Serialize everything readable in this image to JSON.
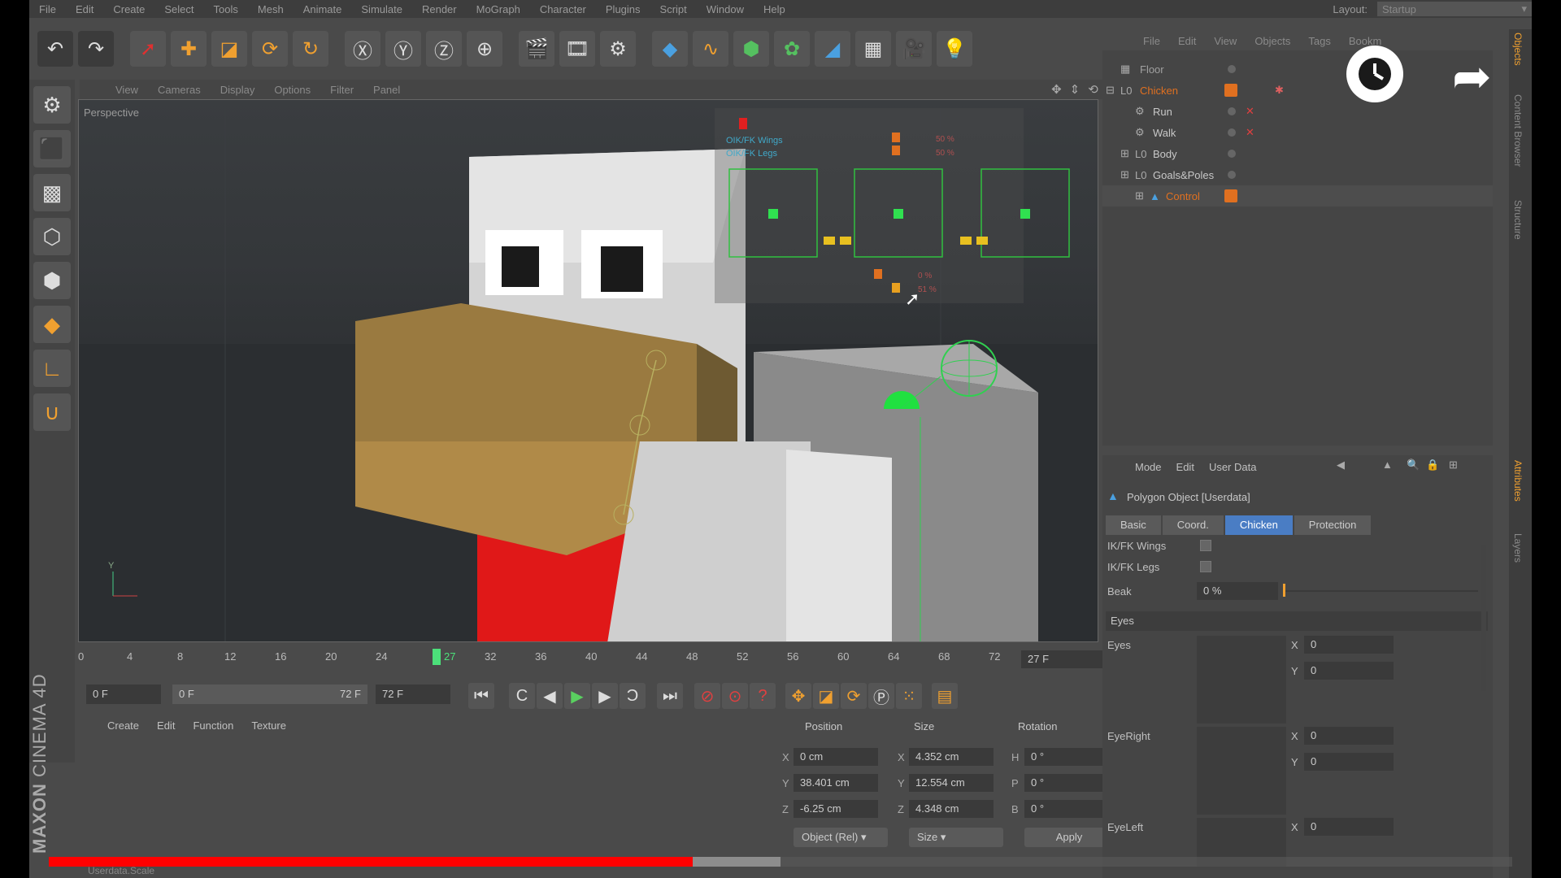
{
  "menu": [
    "File",
    "Edit",
    "Create",
    "Select",
    "Tools",
    "Mesh",
    "Animate",
    "Simulate",
    "Render",
    "MoGraph",
    "Character",
    "Plugins",
    "Script",
    "Window",
    "Help"
  ],
  "layout": {
    "label": "Layout:",
    "value": "Startup"
  },
  "viewport": {
    "menu": [
      "View",
      "Cameras",
      "Display",
      "Options",
      "Filter",
      "Panel"
    ],
    "label": "Perspective",
    "overlay_labels": [
      "OIK/FK Wings",
      "OIK/FK Legs"
    ],
    "slider_values": [
      "50 %",
      "50 %",
      "0 %",
      "51 %"
    ]
  },
  "timeline": {
    "ticks": [
      "0",
      "4",
      "8",
      "12",
      "16",
      "20",
      "24",
      "27",
      "32",
      "36",
      "40",
      "44",
      "48",
      "52",
      "56",
      "60",
      "64",
      "68",
      "72"
    ],
    "current_frame": "27 F",
    "start_field": "0 F",
    "range_start": "0 F",
    "range_end": "72 F",
    "end_field": "72 F"
  },
  "material_manager": {
    "menu": [
      "Create",
      "Edit",
      "Function",
      "Texture"
    ]
  },
  "coordinates": {
    "headers": {
      "position": "Position",
      "size": "Size",
      "rotation": "Rotation"
    },
    "rows": [
      {
        "axis": "X",
        "pos": "0 cm",
        "size": "4.352 cm",
        "rot_label": "H",
        "rot": "0 °"
      },
      {
        "axis": "Y",
        "pos": "38.401 cm",
        "size": "12.554 cm",
        "rot_label": "P",
        "rot": "0 °"
      },
      {
        "axis": "Z",
        "pos": "-6.25 cm",
        "size": "4.348 cm",
        "rot_label": "B",
        "rot": "0 °"
      }
    ],
    "mode": "Object (Rel)",
    "size_mode": "Size",
    "apply": "Apply"
  },
  "object_manager": {
    "menu": [
      "File",
      "Edit",
      "View",
      "Objects",
      "Tags",
      "Bookm"
    ],
    "objects": [
      {
        "name": "Floor",
        "color": "#a0a0a0"
      },
      {
        "name": "Chicken",
        "color": "#e07020"
      },
      {
        "name": "Run",
        "color": "#c8c8c8"
      },
      {
        "name": "Walk",
        "color": "#c8c8c8"
      },
      {
        "name": "Body",
        "color": "#c8c8c8"
      },
      {
        "name": "Goals&Poles",
        "color": "#c8c8c8"
      },
      {
        "name": "Control",
        "color": "#e07020"
      }
    ]
  },
  "attributes": {
    "menu": [
      "Mode",
      "Edit",
      "User Data"
    ],
    "title": "Polygon Object [Userdata]",
    "tabs": [
      "Basic",
      "Coord.",
      "Chicken",
      "Protection"
    ],
    "active_tab": "Chicken",
    "ik_wings": "IK/FK Wings",
    "ik_legs": "IK/FK Legs",
    "beak_label": "Beak",
    "beak_value": "0 %",
    "section_eyes": "Eyes",
    "eyes_label": "Eyes",
    "eyeright_label": "EyeRight",
    "eyeleft_label": "EyeLeft",
    "x_label": "X",
    "y_label": "Y",
    "zero": "0"
  },
  "right_tabs": [
    "Objects",
    "Content Browser",
    "Structure",
    "Attributes",
    "Layers"
  ],
  "brand": {
    "line1": "MAXON",
    "line2": "CINEMA 4D"
  },
  "status": "Userdata.Scale",
  "video_progress": {
    "played": 0.44,
    "buffered": 0.5
  }
}
